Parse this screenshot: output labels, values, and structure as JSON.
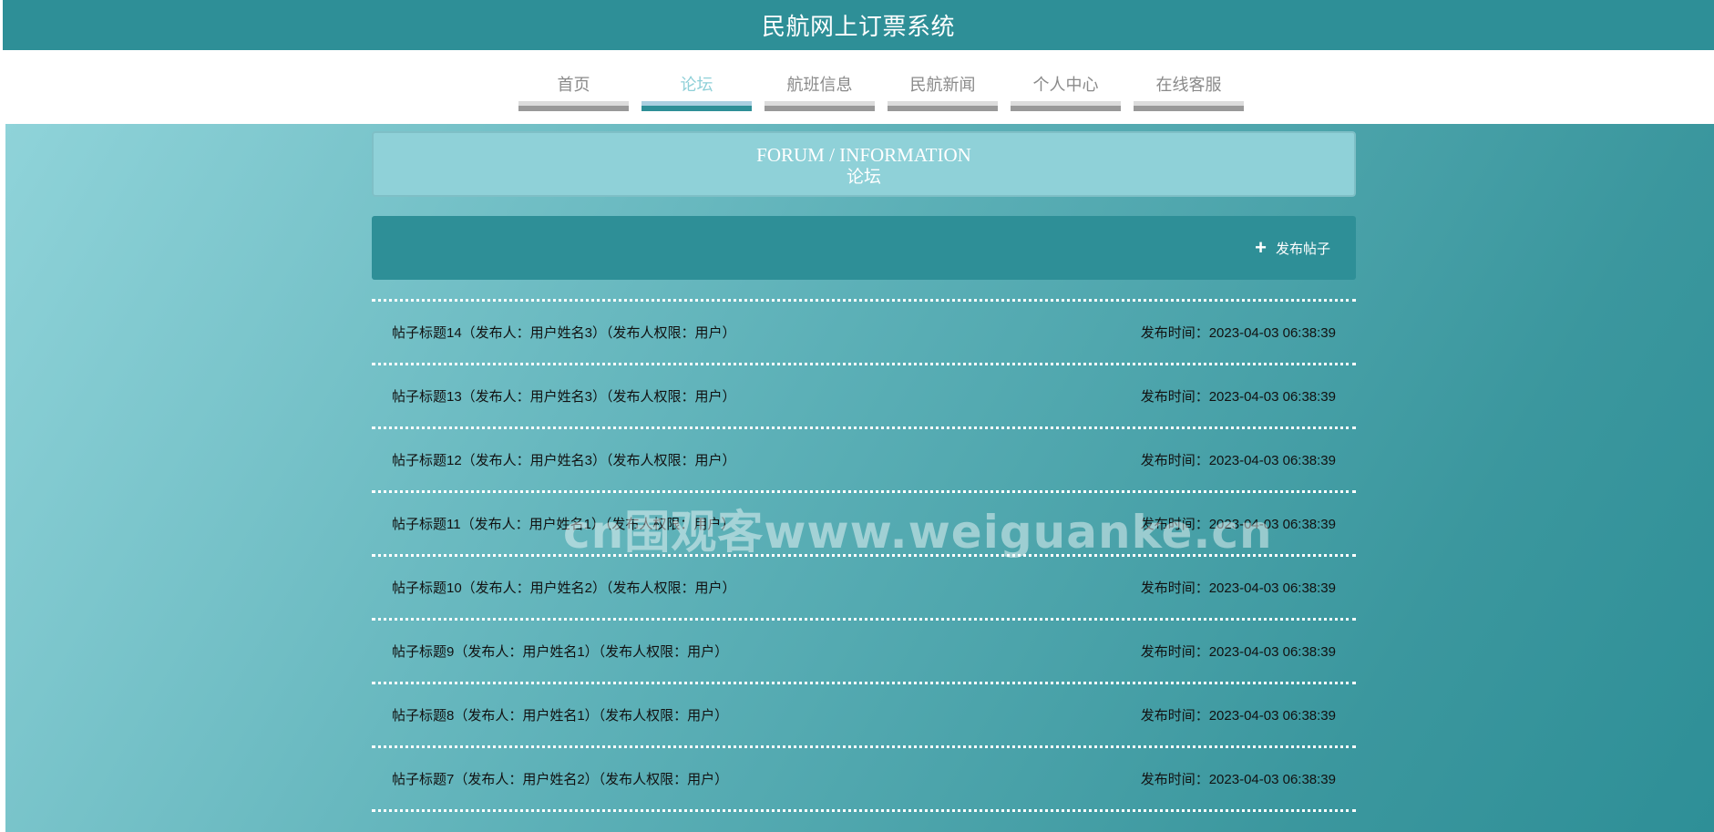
{
  "header": {
    "title": "民航网上订票系统"
  },
  "nav": {
    "items": [
      {
        "label": "首页",
        "active": false
      },
      {
        "label": "论坛",
        "active": true
      },
      {
        "label": "航班信息",
        "active": false
      },
      {
        "label": "民航新闻",
        "active": false
      },
      {
        "label": "个人中心",
        "active": false
      },
      {
        "label": "在线客服",
        "active": false
      }
    ]
  },
  "page": {
    "title_en": "FORUM / INFORMATION",
    "title_cn": "论坛",
    "add_button_label": "发布帖子",
    "add_button_icon": "plus-icon"
  },
  "posts": [
    {
      "title": "帖子标题14（发布人：用户姓名3）（发布人权限：用户）",
      "time": "发布时间：2023-04-03 06:38:39"
    },
    {
      "title": "帖子标题13（发布人：用户姓名3）（发布人权限：用户）",
      "time": "发布时间：2023-04-03 06:38:39"
    },
    {
      "title": "帖子标题12（发布人：用户姓名3）（发布人权限：用户）",
      "time": "发布时间：2023-04-03 06:38:39"
    },
    {
      "title": "帖子标题11（发布人：用户姓名1）（发布人权限：用户）",
      "time": "发布时间：2023-04-03 06:38:39"
    },
    {
      "title": "帖子标题10（发布人：用户姓名2）（发布人权限：用户）",
      "time": "发布时间：2023-04-03 06:38:39"
    },
    {
      "title": "帖子标题9（发布人：用户姓名1）（发布人权限：用户）",
      "time": "发布时间：2023-04-03 06:38:39"
    },
    {
      "title": "帖子标题8（发布人：用户姓名1）（发布人权限：用户）",
      "time": "发布时间：2023-04-03 06:38:39"
    },
    {
      "title": "帖子标题7（发布人：用户姓名2）（发布人权限：用户）",
      "time": "发布时间：2023-04-03 06:38:39"
    }
  ],
  "watermark": "cn围观客www.weiguanke.cn",
  "colors": {
    "primary": "#2e8f97",
    "accent_light": "#8fd1d8",
    "nav_inactive": "#999999"
  }
}
